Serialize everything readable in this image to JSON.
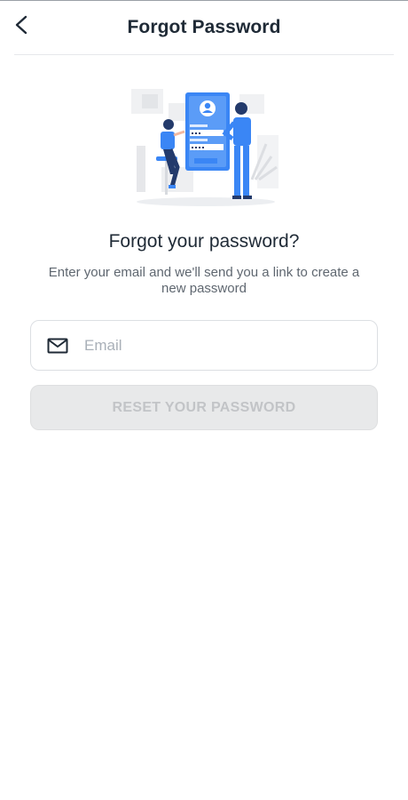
{
  "header": {
    "title": "Forgot Password",
    "back_icon": "chevron-left-icon"
  },
  "main": {
    "illustration": "forgot-password-illustration",
    "headline": "Forgot your password?",
    "subtext": "Enter your email and we'll send you a link to create a new password",
    "email": {
      "icon": "envelope-icon",
      "placeholder": "Email",
      "value": ""
    },
    "reset_button_label": "RESET YOUR PASSWORD"
  },
  "colors": {
    "accent_blue": "#3a86f5",
    "dark_navy": "#233a6b",
    "text_dark": "#1f2a36",
    "disabled_button_bg": "#e8e9ea",
    "disabled_button_text": "#c2c4c7"
  }
}
